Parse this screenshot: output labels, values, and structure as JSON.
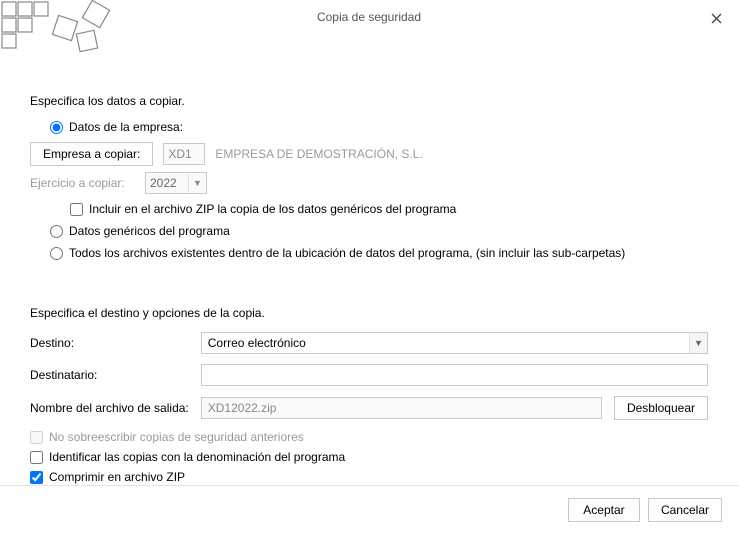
{
  "window": {
    "title": "Copia de seguridad"
  },
  "section1": {
    "header": "Especifica los datos a copiar.",
    "opt_company": "Datos de la empresa:",
    "btn_company": "Empresa a copiar:",
    "company_code": "XD1",
    "company_name": "EMPRESA DE DEMOSTRACIÓN, S.L.",
    "lbl_year": "Ejercicio a copiar:",
    "year": "2022",
    "chk_include_generic": "Incluir en el archivo ZIP la copia de los datos genéricos del programa",
    "opt_generic": "Datos genéricos del programa",
    "opt_all_files": "Todos los archivos existentes dentro de la ubicación de datos del programa, (sin incluir las sub-carpetas)"
  },
  "section2": {
    "header": "Especifica el destino y opciones de la copia.",
    "lbl_dest": "Destino:",
    "dest_value": "Correo electrónico",
    "lbl_recipient": "Destinatario:",
    "recipient_value": "",
    "lbl_outfile": "Nombre del archivo de salida:",
    "outfile_value": "XD12022.zip",
    "btn_unlock": "Desbloquear",
    "chk_no_overwrite": "No sobreescribir copias de seguridad anteriores",
    "chk_identify": "Identificar las copias con la denominación del programa",
    "chk_zip": "Comprimir en archivo ZIP"
  },
  "footer": {
    "ok": "Aceptar",
    "cancel": "Cancelar"
  }
}
